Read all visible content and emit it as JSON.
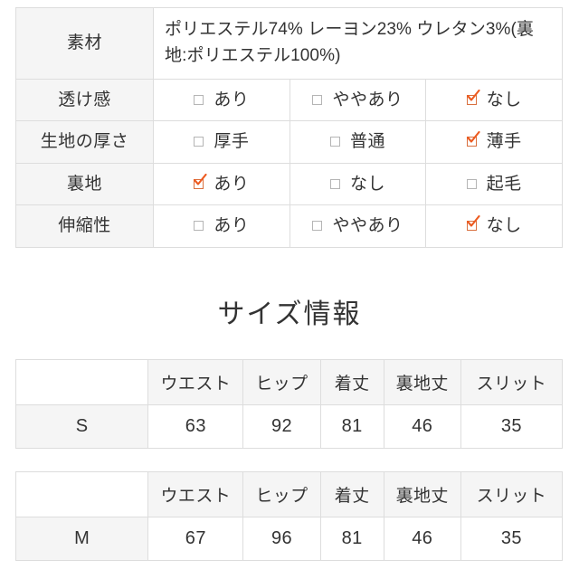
{
  "spec_table": {
    "rows": [
      {
        "label": "素材",
        "type": "text",
        "value": "ポリエステル74% レーヨン23% ウレタン3%(裏地:ポリエステル100%)",
        "value_color": "#fb4d95"
      },
      {
        "label": "透け感",
        "type": "options",
        "options": [
          {
            "label": "あり",
            "checked": false
          },
          {
            "label": "ややあり",
            "checked": false
          },
          {
            "label": "なし",
            "checked": true
          }
        ]
      },
      {
        "label": "生地の厚さ",
        "type": "options",
        "options": [
          {
            "label": "厚手",
            "checked": false
          },
          {
            "label": "普通",
            "checked": false
          },
          {
            "label": "薄手",
            "checked": true
          }
        ]
      },
      {
        "label": "裏地",
        "type": "options",
        "options": [
          {
            "label": "あり",
            "checked": true
          },
          {
            "label": "なし",
            "checked": false
          },
          {
            "label": "起毛",
            "checked": false
          }
        ]
      },
      {
        "label": "伸縮性",
        "type": "options",
        "options": [
          {
            "label": "あり",
            "checked": false
          },
          {
            "label": "ややあり",
            "checked": false
          },
          {
            "label": "なし",
            "checked": true
          }
        ]
      }
    ]
  },
  "size_section": {
    "title": "サイズ情報",
    "columns": [
      "",
      "ウエスト",
      "ヒップ",
      "着丈",
      "裏地丈",
      "スリット"
    ],
    "tables": [
      {
        "size": "S",
        "values": [
          "63",
          "92",
          "81",
          "46",
          "35"
        ]
      },
      {
        "size": "M",
        "values": [
          "67",
          "96",
          "81",
          "46",
          "35"
        ]
      }
    ]
  },
  "colors": {
    "material_pink": "#fb4d95",
    "checked_orange": "#ed5a1f",
    "header_gray": "#f5f5f5",
    "border_gray": "#dddddd",
    "text": "#333333"
  },
  "icons": {
    "checked": "checkbox-checked-icon",
    "unchecked": "checkbox-unchecked-icon"
  }
}
